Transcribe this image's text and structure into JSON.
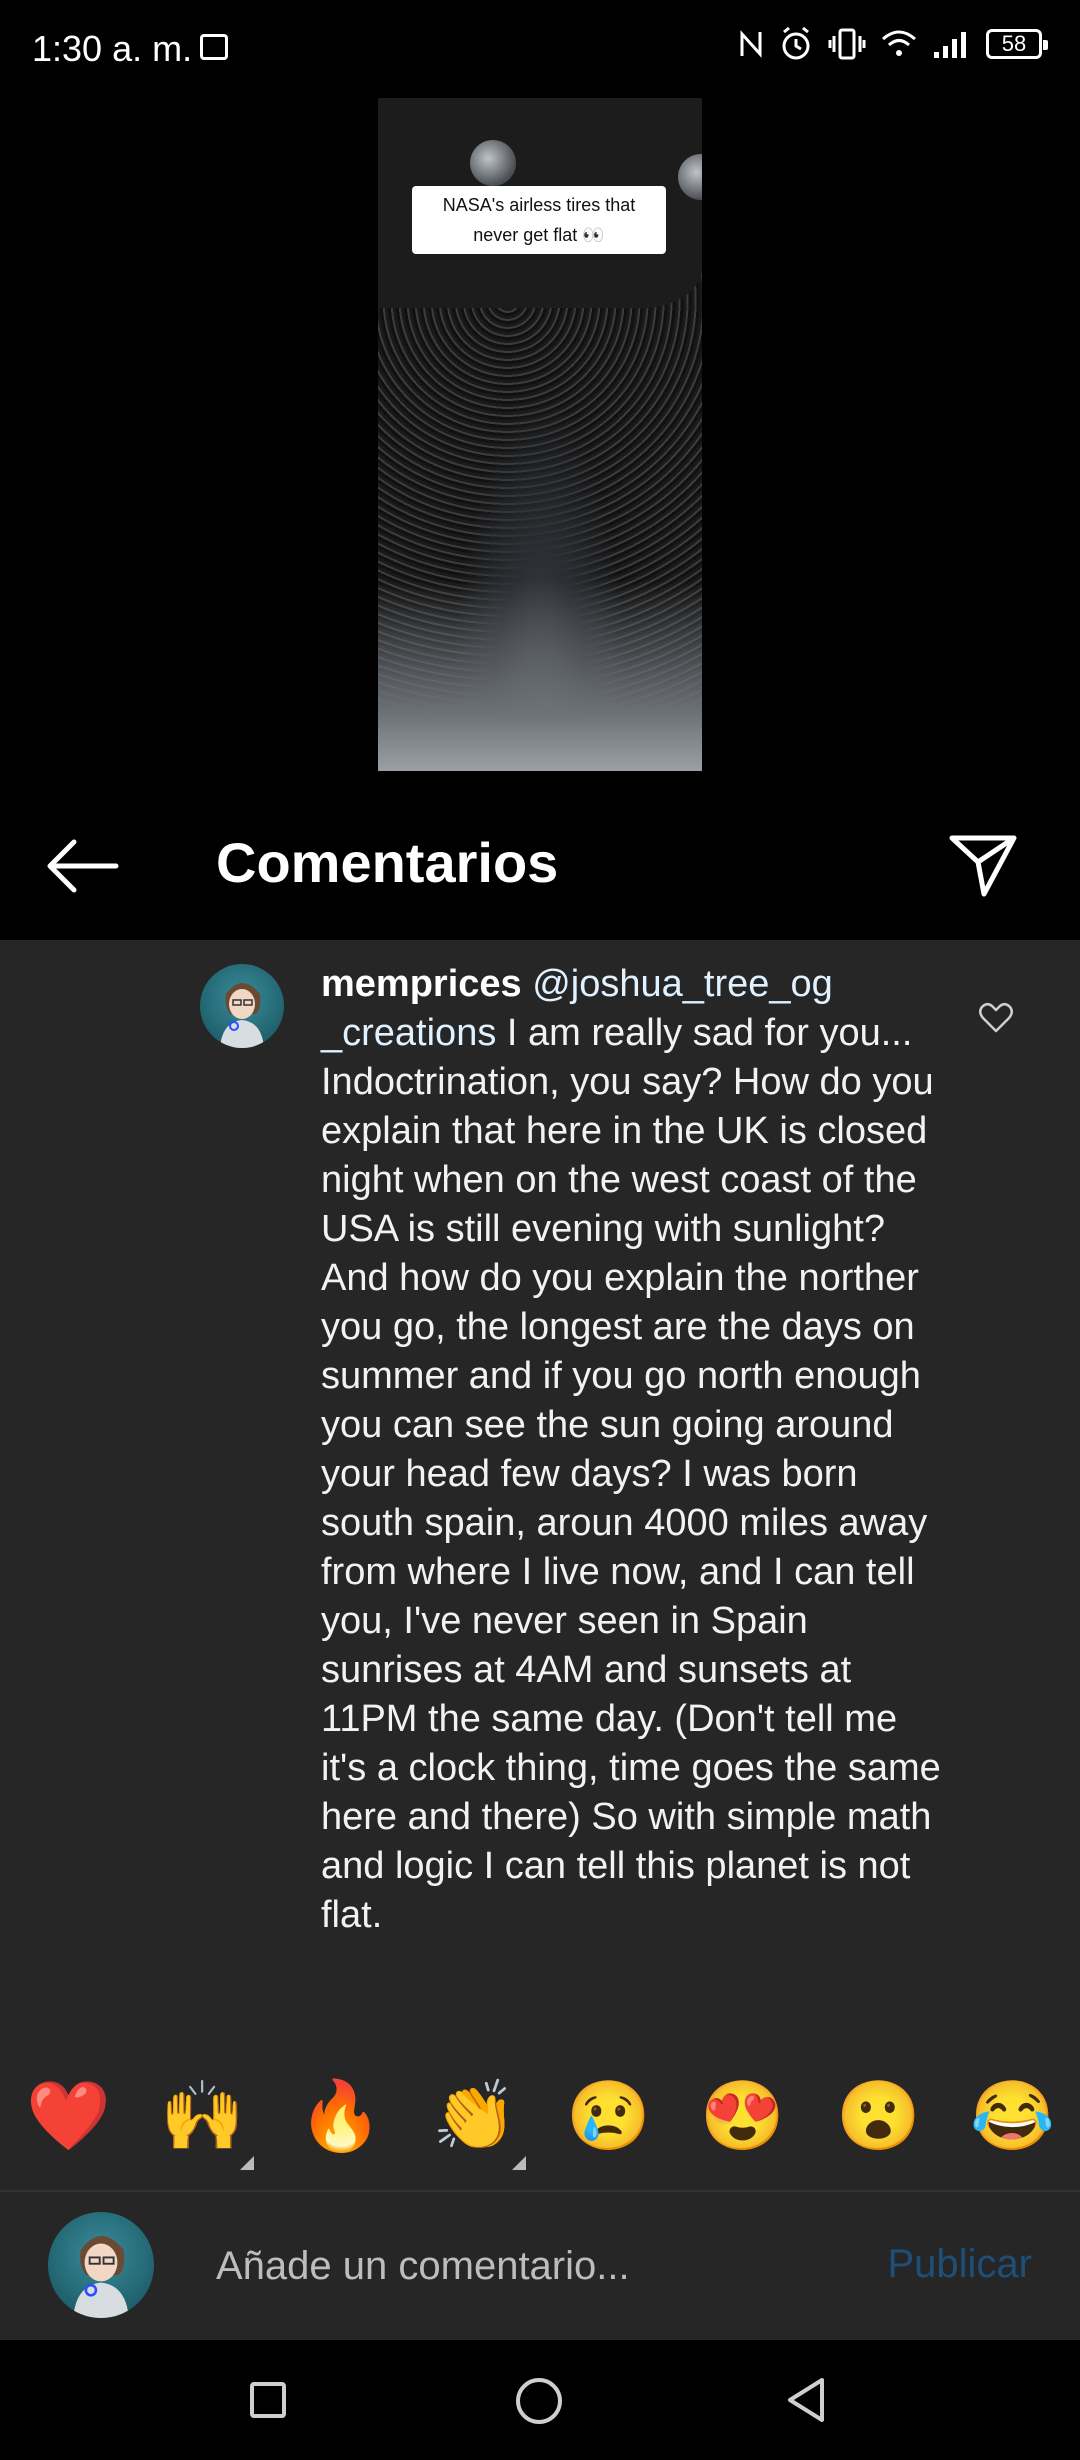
{
  "status_bar": {
    "time": "1:30 a. m.",
    "battery": "58",
    "icons": [
      "gallery-icon",
      "nfc-icon",
      "alarm-icon",
      "vibrate-icon",
      "wifi-icon",
      "signal-icon",
      "battery-icon"
    ]
  },
  "video": {
    "caption": "NASA's airless tires that never get flat 👀"
  },
  "header": {
    "title": "Comentarios"
  },
  "comment": {
    "username": "memprices",
    "mention": "@joshua_tree_og _creations",
    "text": "I am really sad for you... Indoctrination, you say? How do you explain that here in the UK is closed night when on the west coast of the USA is still evening with sunlight? And how do you explain the norther you go, the longest are the days on summer and if you go north enough you can see the sun going around your head few days? I was born south spain, aroun 4000 miles away from where I live now, and I can tell you, I've never seen in Spain sunrises at 4AM and sunsets at 11PM the same day. (Don't tell me it's a clock thing, time goes the same here and there) So with simple math and logic I can tell this planet is not flat."
  },
  "emoji_bar": {
    "emojis": [
      "❤️",
      "🙌",
      "🔥",
      "👏",
      "😢",
      "😍",
      "😮",
      "😂"
    ]
  },
  "composer": {
    "placeholder": "Añade un comentario...",
    "publish_label": "Publicar"
  },
  "colors": {
    "background": "#000000",
    "panel": "#262626",
    "publish_disabled": "#1e4f79"
  }
}
